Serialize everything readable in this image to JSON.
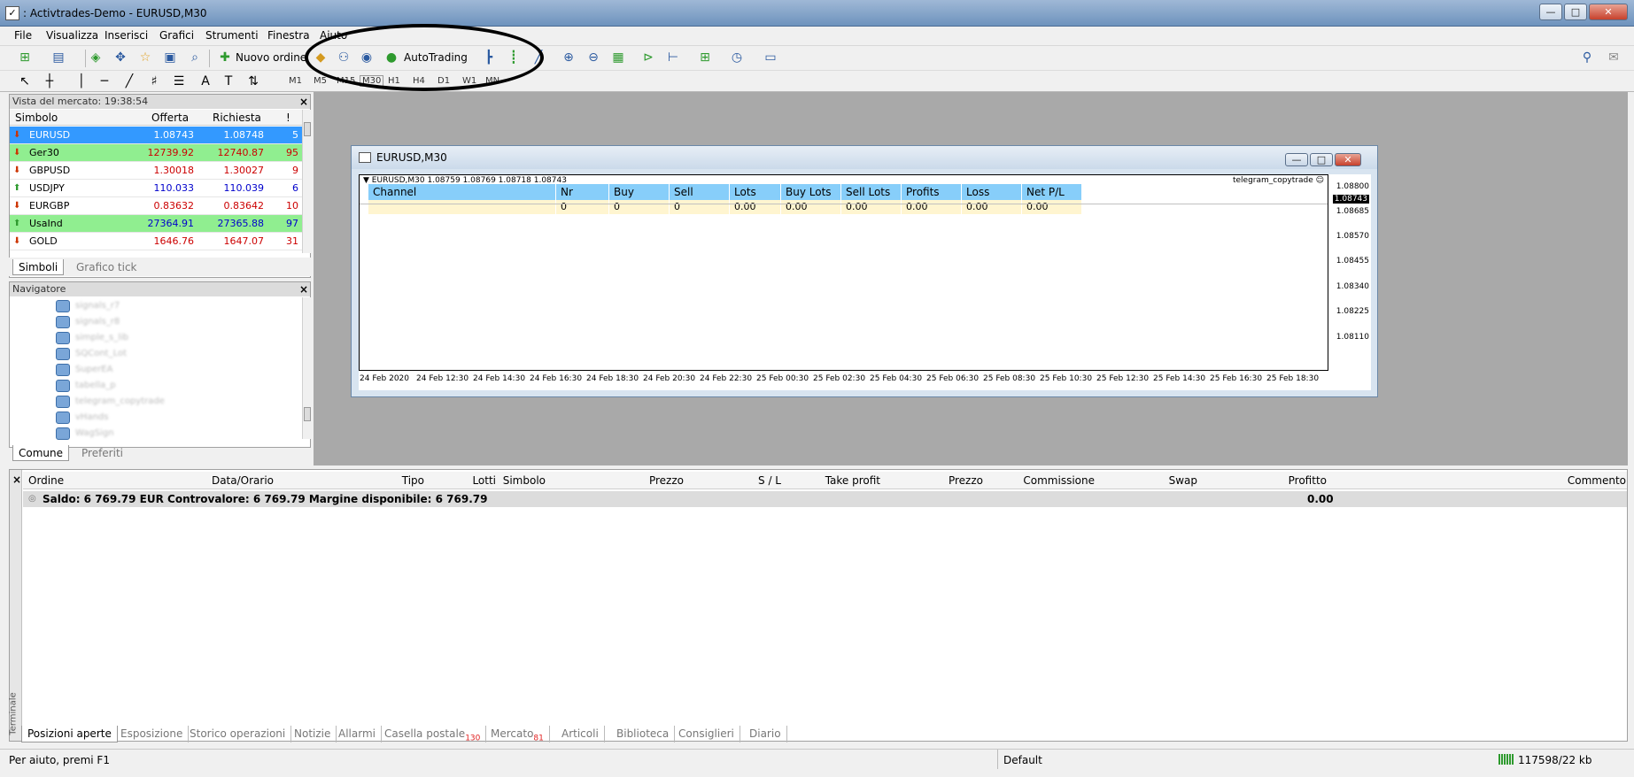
{
  "window": {
    "title": ": Activtrades-Demo - EURUSD,M30",
    "app_icon": "✓",
    "minimize": "—",
    "maximize": "□",
    "close": "✕"
  },
  "menu": [
    "File",
    "Visualizza",
    "Inserisci",
    "Grafici",
    "Strumenti",
    "Finestra",
    "Aiuto"
  ],
  "toolbar": {
    "new_order": "Nuovo ordine",
    "autotrading": "AutoTrading"
  },
  "timeframes": [
    "M1",
    "M5",
    "M15",
    "M30",
    "H1",
    "H4",
    "D1",
    "W1",
    "MN"
  ],
  "market_watch": {
    "title": "Vista del mercato: 19:38:54",
    "headers": {
      "symbol": "Simbolo",
      "bid": "Offerta",
      "ask": "Richiesta",
      "spread": "!"
    },
    "rows": [
      {
        "symbol": "EURUSD",
        "bid": "1.08743",
        "ask": "1.08748",
        "spread": "5",
        "dir": "down",
        "bg": "#3399ff",
        "color": "#ffffff"
      },
      {
        "symbol": "Ger30",
        "bid": "12739.92",
        "ask": "12740.87",
        "spread": "95",
        "dir": "down",
        "bg": "#90ee90",
        "color": "#cc0000"
      },
      {
        "symbol": "GBPUSD",
        "bid": "1.30018",
        "ask": "1.30027",
        "spread": "9",
        "dir": "down",
        "bg": "#ffffff",
        "color": "#cc0000"
      },
      {
        "symbol": "USDJPY",
        "bid": "110.033",
        "ask": "110.039",
        "spread": "6",
        "dir": "up",
        "bg": "#ffffff",
        "color": "#0000cc"
      },
      {
        "symbol": "EURGBP",
        "bid": "0.83632",
        "ask": "0.83642",
        "spread": "10",
        "dir": "down",
        "bg": "#ffffff",
        "color": "#cc0000"
      },
      {
        "symbol": "UsaInd",
        "bid": "27364.91",
        "ask": "27365.88",
        "spread": "97",
        "dir": "up",
        "bg": "#90ee90",
        "color": "#0000cc"
      },
      {
        "symbol": "GOLD",
        "bid": "1646.76",
        "ask": "1647.07",
        "spread": "31",
        "dir": "down",
        "bg": "#ffffff",
        "color": "#cc0000"
      }
    ],
    "tabs": [
      "Simboli",
      "Grafico tick"
    ]
  },
  "navigator": {
    "title": "Navigatore",
    "items": [
      "signals_r7",
      "signals_r8",
      "simple_s_lib",
      "SQCont_Lot",
      "SuperEA",
      "tabella_p",
      "telegram_copytrade",
      "vHands",
      "WagSign"
    ],
    "tabs": [
      "Comune",
      "Preferiti"
    ]
  },
  "chart": {
    "window_title": "EURUSD,M30",
    "info_line": "EURUSD,M30  1.08759 1.08769 1.08718 1.08743",
    "ea_label": "telegram_copytrade ☺",
    "current_price": "1.08743",
    "price_labels": [
      "1.08800",
      "1.08743",
      "1.08685",
      "1.08570",
      "1.08455",
      "1.08340",
      "1.08225",
      "1.08110"
    ],
    "time_labels": [
      "24 Feb 2020",
      "24 Feb 12:30",
      "24 Feb 14:30",
      "24 Feb 16:30",
      "24 Feb 18:30",
      "24 Feb 20:30",
      "24 Feb 22:30",
      "25 Feb 00:30",
      "25 Feb 02:30",
      "25 Feb 04:30",
      "25 Feb 06:30",
      "25 Feb 08:30",
      "25 Feb 10:30",
      "25 Feb 12:30",
      "25 Feb 14:30",
      "25 Feb 16:30",
      "25 Feb 18:30"
    ],
    "table_headers": [
      "Channel",
      "Nr trades",
      "Buy Trades",
      "Sell Trades",
      "Lots",
      "Buy Lots",
      "Sell Lots",
      "Profits",
      "Loss",
      "Net P/L"
    ],
    "table_values": [
      "",
      "0",
      "0",
      "0",
      "0.00",
      "0.00",
      "0.00",
      "0.00",
      "0.00",
      "0.00"
    ]
  },
  "terminal": {
    "side_label": "Terminale",
    "headers": [
      "Ordine",
      "Data/Orario",
      "Tipo",
      "Lotti",
      "Simbolo",
      "Prezzo",
      "S / L",
      "Take profit",
      "Prezzo",
      "Commissione",
      "Swap",
      "Profitto",
      "Commento"
    ],
    "balance_text": "Saldo: 6 769.79 EUR  Controvalore: 6 769.79  Margine disponibile: 6 769.79",
    "balance_profit": "0.00",
    "tabs": [
      "Posizioni aperte",
      "Esposizione",
      "Storico operazioni",
      "Notizie",
      "Allarmi",
      "Casella postale",
      "Mercato",
      "Articoli",
      "Biblioteca",
      "Consiglieri",
      "Diario"
    ],
    "badge_mail": "130",
    "badge_market": "81"
  },
  "status": {
    "help": "Per aiuto, premi F1",
    "profile": "Default",
    "traffic": "117598/22 kb"
  }
}
